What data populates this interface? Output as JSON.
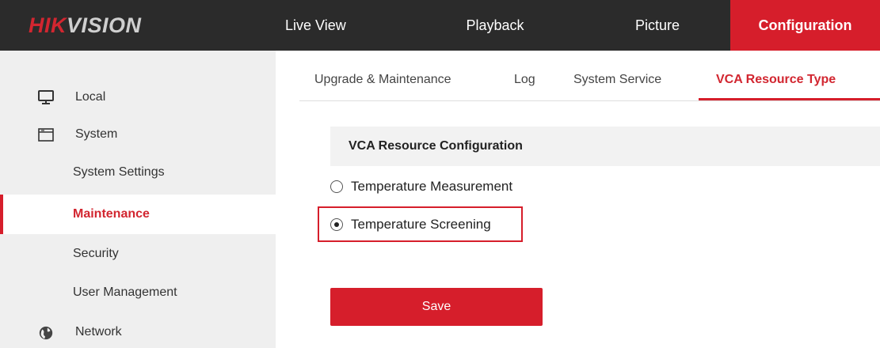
{
  "logo": {
    "part1": "HIK",
    "part2": "VISION"
  },
  "nav": {
    "tabs": [
      {
        "label": "Live View"
      },
      {
        "label": "Playback"
      },
      {
        "label": "Picture"
      },
      {
        "label": "Configuration",
        "active": true
      }
    ]
  },
  "sidebar": {
    "items": [
      {
        "label": "Local",
        "icon": "monitor-icon"
      },
      {
        "label": "System",
        "icon": "window-icon"
      },
      {
        "label": "System Settings"
      },
      {
        "label": "Maintenance",
        "active": true
      },
      {
        "label": "Security"
      },
      {
        "label": "User Management"
      },
      {
        "label": "Network",
        "icon": "globe-icon"
      }
    ]
  },
  "subtabs": [
    {
      "label": "Upgrade & Maintenance"
    },
    {
      "label": "Log"
    },
    {
      "label": "System Service"
    },
    {
      "label": "VCA Resource Type",
      "active": true
    }
  ],
  "section": {
    "title": "VCA Resource Configuration"
  },
  "options": [
    {
      "label": "Temperature Measurement",
      "selected": false
    },
    {
      "label": "Temperature Screening",
      "selected": true
    }
  ],
  "actions": {
    "save_label": "Save"
  },
  "colors": {
    "accent": "#d61e2b",
    "topbar": "#2b2b2b",
    "sidebar": "#efefef"
  }
}
